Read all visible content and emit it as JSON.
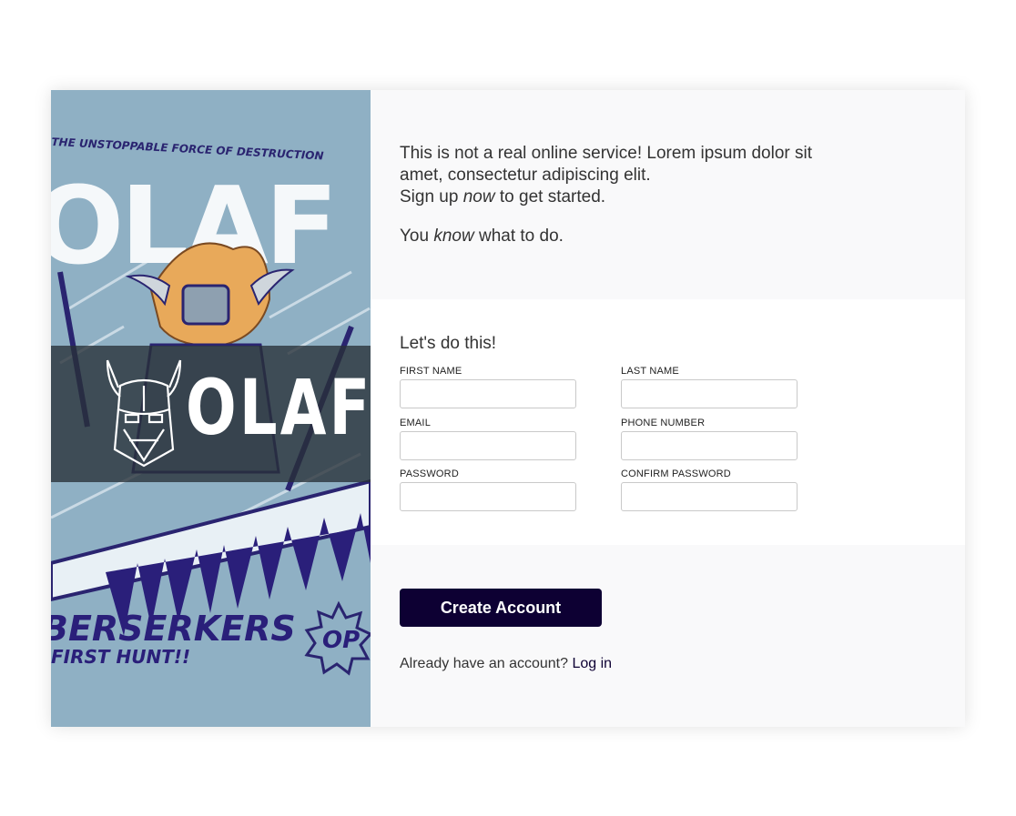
{
  "art": {
    "banner_text": "THE UNSTOPPABLE FORCE OF DESTRUCTION",
    "title_text": "OLAF",
    "subtitle_text": "BERSERKERS",
    "subtitle2_text": "FIRST HUNT!!",
    "badge_text": "OP",
    "brand_name": "OLAF"
  },
  "intro": {
    "line1": "This is not a real online service! Lorem ipsum dolor sit amet, consectetur adipiscing elit.",
    "line2_prefix": "Sign up ",
    "line2_em": "now",
    "line2_suffix": " to get started.",
    "line3_prefix": "You ",
    "line3_em": "know",
    "line3_suffix": " what to do."
  },
  "form": {
    "heading": "Let's do this!",
    "fields": [
      {
        "label": "FIRST NAME",
        "value": ""
      },
      {
        "label": "LAST NAME",
        "value": ""
      },
      {
        "label": "EMAIL",
        "value": ""
      },
      {
        "label": "PHONE NUMBER",
        "value": ""
      },
      {
        "label": "PASSWORD",
        "value": ""
      },
      {
        "label": "CONFIRM PASSWORD",
        "value": ""
      }
    ]
  },
  "actions": {
    "submit_label": "Create Account",
    "login_prompt": "Already have an account?",
    "login_link": "Log in"
  },
  "colors": {
    "accent": "#0d0033",
    "panel_bg": "#f9f9fa",
    "art_bg": "#8fb0c4"
  },
  "icons": {
    "brand_logo": "viking-helmet-icon"
  }
}
